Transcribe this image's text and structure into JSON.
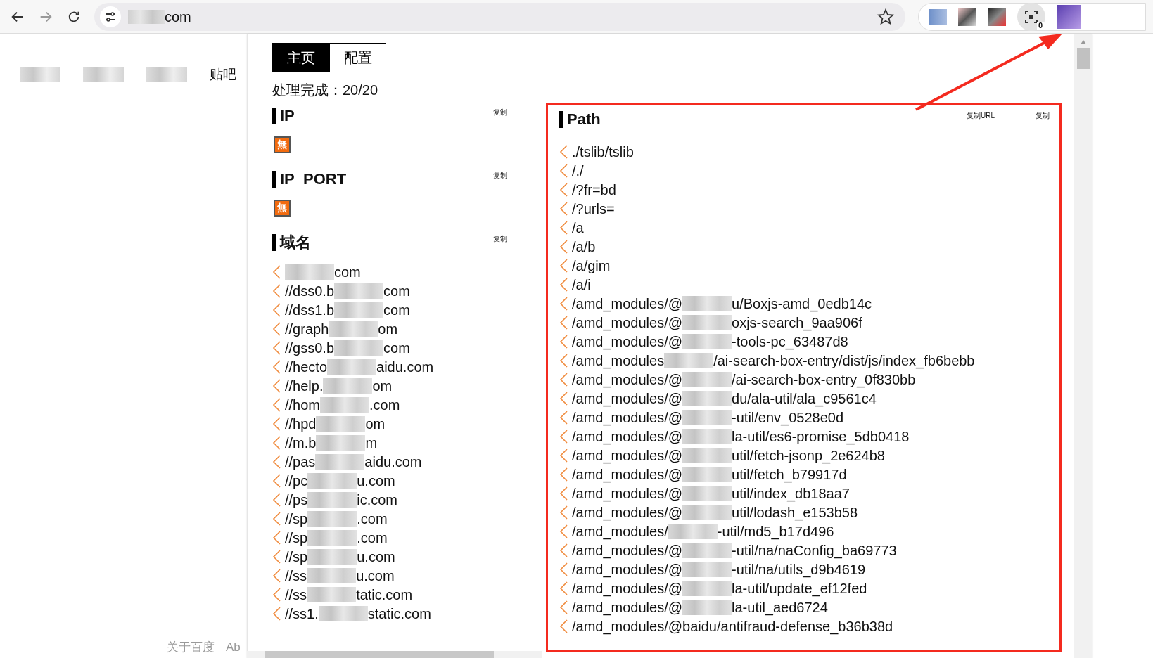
{
  "browser": {
    "url_visible": "com",
    "extension_badge": "0"
  },
  "page_nav": [
    {
      "kind": "blurred"
    },
    {
      "kind": "blurred"
    },
    {
      "kind": "blurred"
    },
    {
      "kind": "text",
      "label": "贴吧"
    }
  ],
  "page_footer": [
    "关于百度",
    "Ab"
  ],
  "popup": {
    "tabs": [
      {
        "label": "主页",
        "selected": true
      },
      {
        "label": "配置",
        "selected": false
      }
    ],
    "status": "处理完成：20/20",
    "sections": [
      {
        "title": "IP",
        "copy_buttons": [
          "复制"
        ],
        "empty_badge": "無"
      },
      {
        "title": "IP_PORT",
        "copy_buttons": [
          "复制"
        ],
        "empty_badge": "無"
      },
      {
        "title": "域名",
        "copy_buttons": [
          "复制"
        ],
        "items": [
          {
            "end": "com"
          },
          {
            "start": "//dss0.b",
            "end": "com"
          },
          {
            "start": "//dss1.b",
            "end": "com"
          },
          {
            "start": "//graph",
            "end": "om"
          },
          {
            "start": "//gss0.b",
            "end": "com"
          },
          {
            "start": "//hecto",
            "end": "aidu.com"
          },
          {
            "start": "//help.",
            "end": "om"
          },
          {
            "start": "//hom",
            "end": ".com"
          },
          {
            "start": "//hpd",
            "end": "om"
          },
          {
            "start": "//m.b",
            "end": "m"
          },
          {
            "start": "//pas",
            "end": "aidu.com"
          },
          {
            "start": "//pc",
            "end": "u.com"
          },
          {
            "start": "//ps",
            "end": "ic.com"
          },
          {
            "start": "//sp",
            "end": ".com"
          },
          {
            "start": "//sp",
            "end": ".com"
          },
          {
            "start": "//sp",
            "end": "u.com"
          },
          {
            "start": "//ss",
            "end": "u.com"
          },
          {
            "start": "//ss",
            "end": "tatic.com"
          },
          {
            "start": "//ss1.",
            "end": "static.com"
          }
        ]
      }
    ],
    "path_section": {
      "title": "Path",
      "copy_buttons": [
        "复制URL",
        "复制"
      ],
      "items": [
        {
          "start": "./tslib/tslib"
        },
        {
          "start": "/./"
        },
        {
          "start": "/?fr=bd"
        },
        {
          "start": "/?urls="
        },
        {
          "start": "/a"
        },
        {
          "start": "/a/b"
        },
        {
          "start": "/a/gim"
        },
        {
          "start": "/a/i"
        },
        {
          "start": "/amd_modules/@",
          "end": "u/Boxjs-amd_0edb14c"
        },
        {
          "start": "/amd_modules/@",
          "end": "oxjs-search_9aa906f"
        },
        {
          "start": "/amd_modules/@",
          "end": "-tools-pc_63487d8"
        },
        {
          "start": "/amd_modules",
          "end": "/ai-search-box-entry/dist/js/index_fb6bebb"
        },
        {
          "start": "/amd_modules/@",
          "end": "/ai-search-box-entry_0f830bb"
        },
        {
          "start": "/amd_modules/@",
          "end": "du/ala-util/ala_c9561c4"
        },
        {
          "start": "/amd_modules/@",
          "end": "-util/env_0528e0d"
        },
        {
          "start": "/amd_modules/@",
          "end": "la-util/es6-promise_5db0418"
        },
        {
          "start": "/amd_modules/@",
          "end": "util/fetch-jsonp_2e624b8"
        },
        {
          "start": "/amd_modules/@",
          "end": "util/fetch_b79917d"
        },
        {
          "start": "/amd_modules/@",
          "end": "util/index_db18aa7"
        },
        {
          "start": "/amd_modules/@",
          "end": "util/lodash_e153b58"
        },
        {
          "start": "/amd_modules/",
          "end": "-util/md5_b17d496"
        },
        {
          "start": "/amd_modules/@",
          "end": "-util/na/naConfig_ba69773"
        },
        {
          "start": "/amd_modules/@",
          "end": "-util/na/utils_d9b4619"
        },
        {
          "start": "/amd_modules/@",
          "end": "la-util/update_ef12fed"
        },
        {
          "start": "/amd_modules/@",
          "end": "la-util_aed6724"
        },
        {
          "start": "/amd_modules/@baidu/antifraud-defense_b36b38d"
        }
      ]
    }
  }
}
